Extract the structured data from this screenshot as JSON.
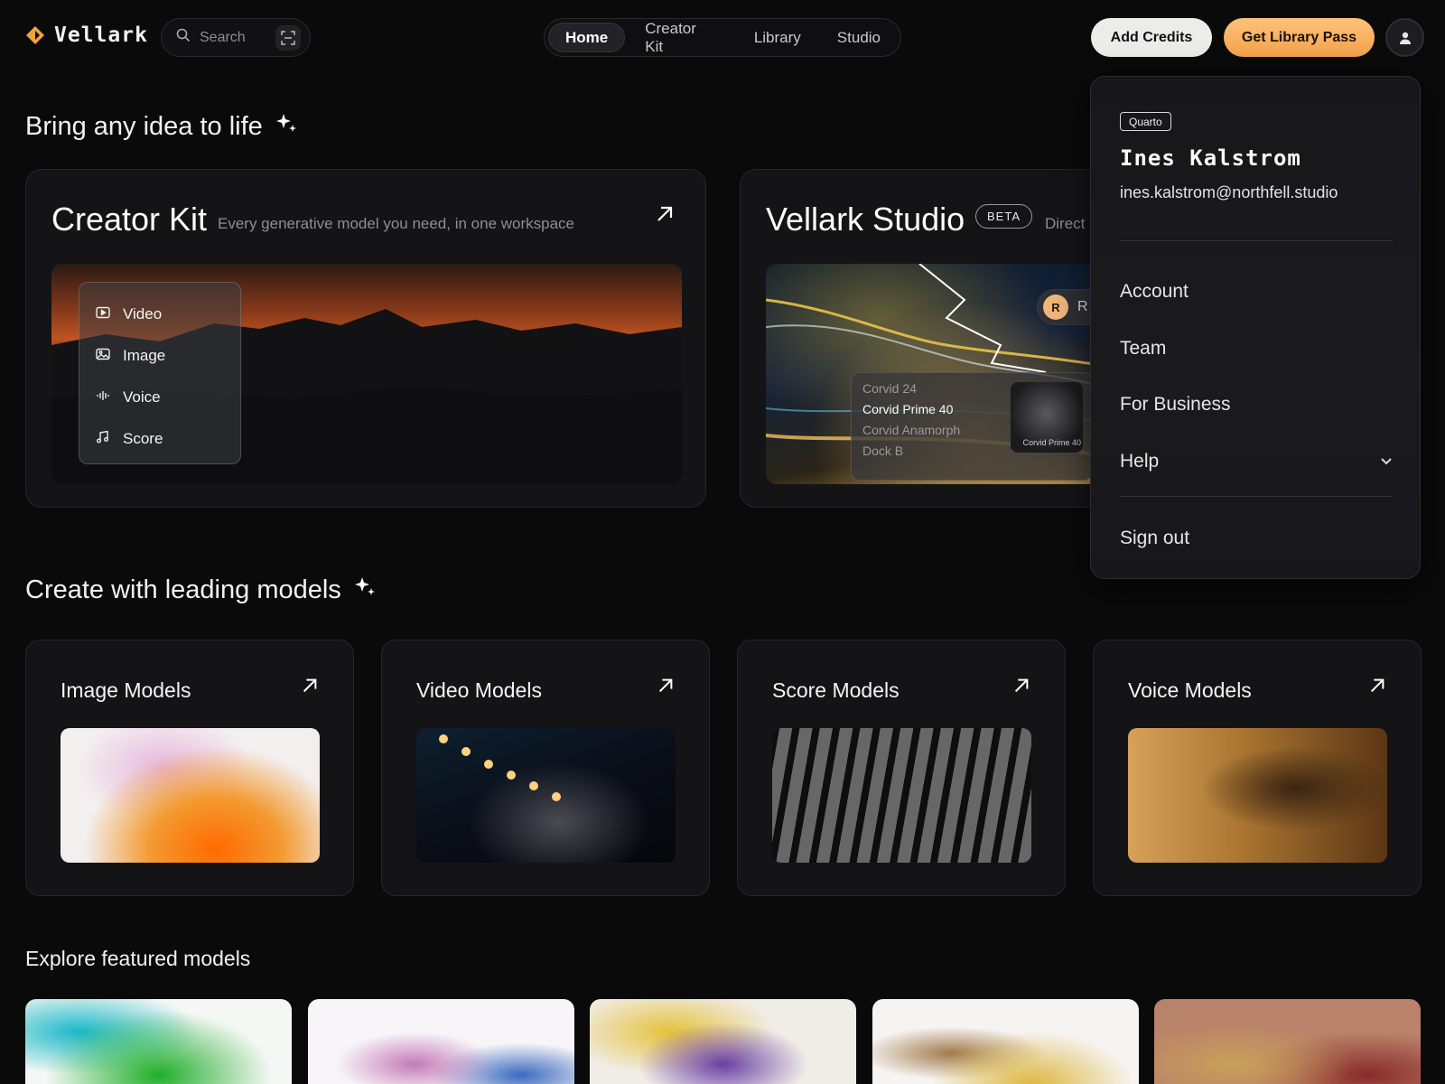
{
  "header": {
    "brand": "Vellark",
    "search_placeholder": "Search",
    "nav": [
      "Home",
      "Creator Kit",
      "Library",
      "Studio"
    ],
    "active_nav": "Home",
    "add_credits": "Add Credits",
    "get_pass": "Get Library Pass"
  },
  "hero": {
    "title": "Bring any idea to life",
    "creator_kit": {
      "title": "Creator Kit",
      "subtitle": "Every generative model you need, in one workspace",
      "menu": [
        {
          "label": "Video",
          "icon": "video-icon"
        },
        {
          "label": "Image",
          "icon": "image-icon"
        },
        {
          "label": "Voice",
          "icon": "waveform-icon"
        },
        {
          "label": "Score",
          "icon": "music-note-icon"
        }
      ]
    },
    "studio": {
      "title": "Vellark Studio",
      "badge": "BETA",
      "subtitle": "Direct",
      "chip_initial": "R",
      "chip_text": "R",
      "lenses": [
        "Corvid 24",
        "Corvid Prime 40",
        "Corvid Anamorph",
        "Dock B"
      ],
      "selected_lens": "Corvid Prime 40",
      "thumb_caption": "Corvid Prime 40"
    }
  },
  "models": {
    "title": "Create with leading models",
    "cards": [
      "Image Models",
      "Video Models",
      "Score Models",
      "Voice Models"
    ]
  },
  "featured": {
    "title": "Explore featured models"
  },
  "account_menu": {
    "plan": "Quarto",
    "name": "Ines Kalstrom",
    "email": "ines.kalstrom@northfell.studio",
    "items": [
      "Account",
      "Team",
      "For Business",
      "Help"
    ],
    "sign_out": "Sign out"
  },
  "colors": {
    "background": "#0a0a0b",
    "accent_orange": "#f4a24b",
    "logo_orange": "#f0a33a"
  }
}
